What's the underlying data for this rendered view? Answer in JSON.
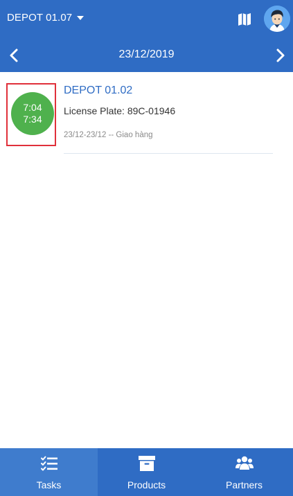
{
  "header": {
    "depot_selector_label": "DEPOT 01.07",
    "date": "23/12/2019"
  },
  "tasks": [
    {
      "start_time": "7:04",
      "end_time": "7:34",
      "title": "DEPOT 01.02",
      "license_plate": "License Plate: 89C-01946",
      "meta": "23/12-23/12 --  Giao hàng"
    }
  ],
  "bottom_nav": {
    "tabs": [
      {
        "label": "Tasks",
        "icon": "tasks-icon",
        "active": true
      },
      {
        "label": "Products",
        "icon": "archive-box-icon",
        "active": false
      },
      {
        "label": "Partners",
        "icon": "users-icon",
        "active": false
      }
    ]
  },
  "colors": {
    "primary": "#2f6cc4",
    "active_tab": "#3f7ccd",
    "time_circle": "#4fb14d",
    "highlight_border": "#e0303a"
  }
}
